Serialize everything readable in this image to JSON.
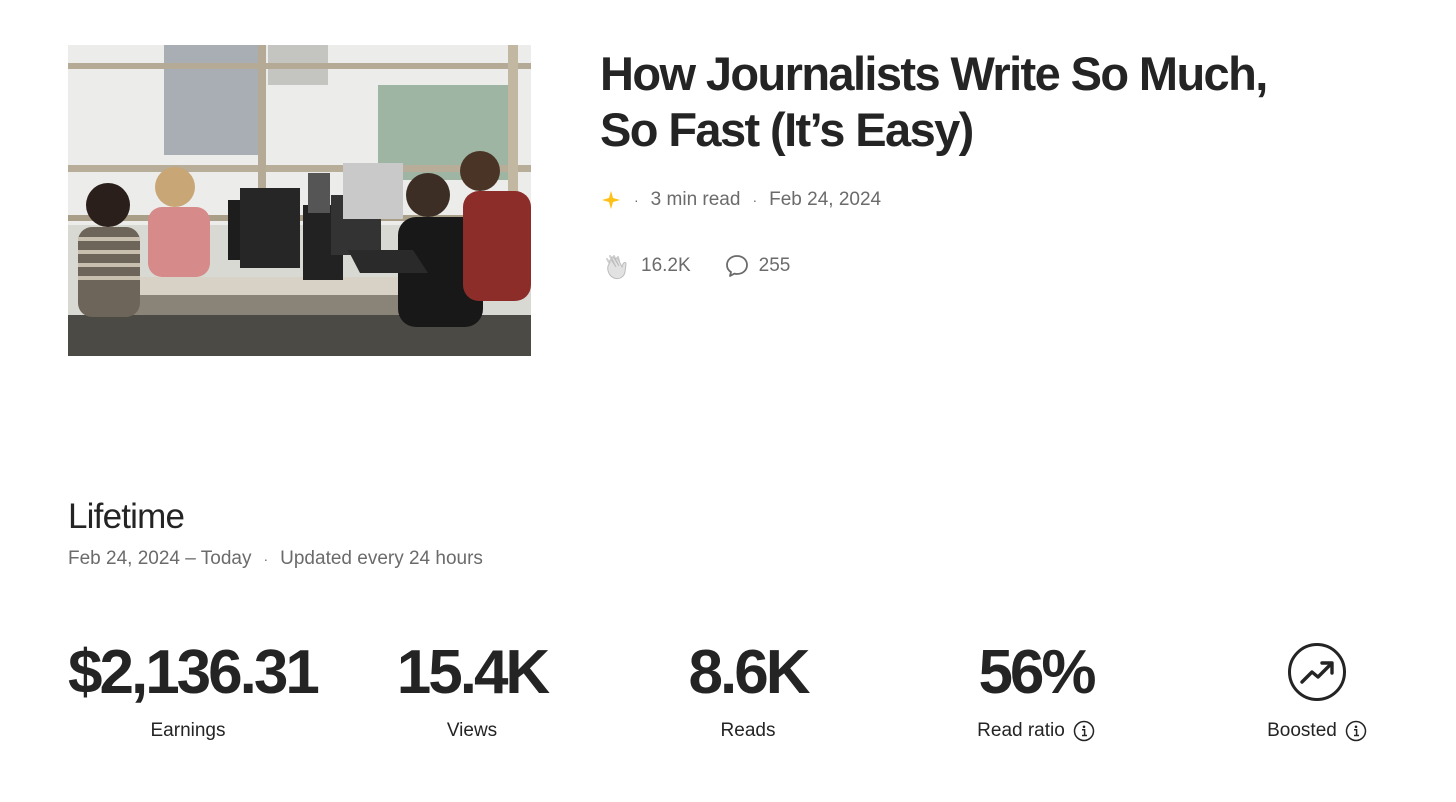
{
  "story": {
    "title_line1": "How Journalists Write So Much,",
    "title_line2": "So Fast (It’s Easy)",
    "read_time": "3 min read",
    "date": "Feb 24, 2024",
    "claps": "16.2K",
    "responses": "255"
  },
  "lifetime": {
    "heading": "Lifetime",
    "range": "Feb 24, 2024 – Today",
    "update_note": "Updated every 24 hours"
  },
  "stats": {
    "earnings_value": "$2,136.31",
    "earnings_label": "Earnings",
    "views_value": "15.4K",
    "views_label": "Views",
    "reads_value": "8.6K",
    "reads_label": "Reads",
    "ratio_value": "56%",
    "ratio_label": "Read ratio",
    "boosted_label": "Boosted"
  },
  "icons": {
    "member_star": "sparkle-star-icon",
    "claps": "clap-hands-icon",
    "responses": "speech-bubble-icon",
    "info": "info-circle-icon",
    "boosted": "trending-up-circle-icon"
  },
  "colors": {
    "text": "#242424",
    "muted": "#6b6b6b",
    "star": "#FFC017"
  }
}
